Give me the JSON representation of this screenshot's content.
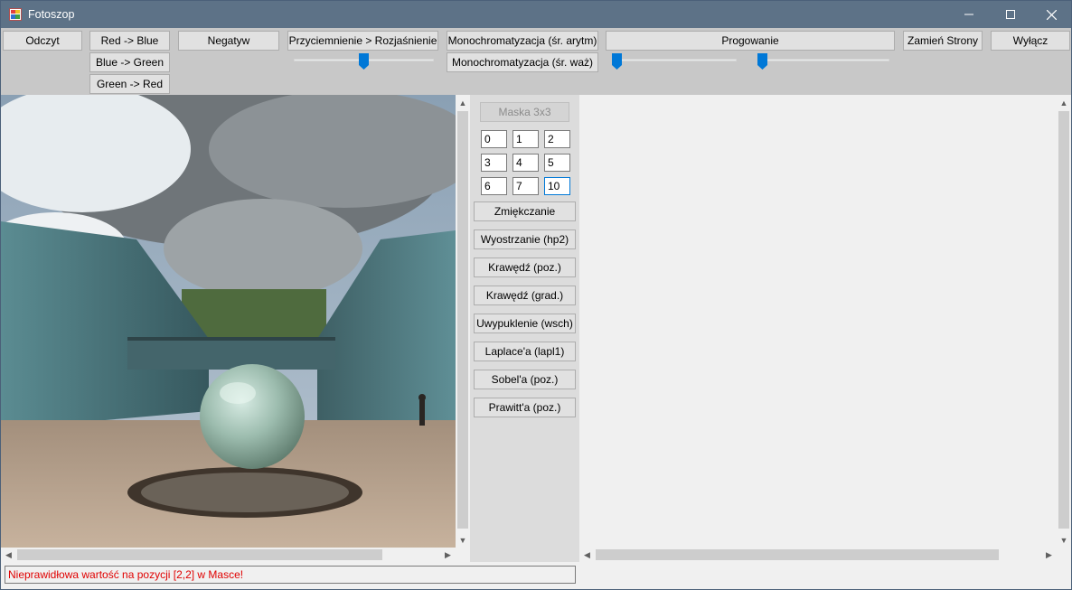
{
  "window": {
    "title": "Fotoszop",
    "controls": {
      "minimize": "minimize-icon",
      "maximize": "maximize-icon",
      "close": "close-icon"
    }
  },
  "toolbar": {
    "read_label": "Odczyt",
    "red_blue_label": "Red -> Blue",
    "blue_green_label": "Blue -> Green",
    "green_red_label": "Green -> Red",
    "negative_label": "Negatyw",
    "brightness_label": "Przyciemnienie > Rozjaśnienie",
    "brightness_slider_value": 0.5,
    "mono_avg_label": "Monochromatyzacja (śr. arytm)",
    "mono_weighted_label": "Monochromatyzacja (śr. waż)",
    "threshold_label": "Progowanie",
    "threshold_slider1_value": 0.0,
    "threshold_slider2_value": 0.0,
    "swap_sides_label": "Zamień Strony",
    "exit_label": "Wyłącz"
  },
  "mask": {
    "title": "Maska 3x3",
    "cells": [
      "0",
      "1",
      "2",
      "3",
      "4",
      "5",
      "6",
      "7",
      "10"
    ]
  },
  "filters": [
    "Zmiękczanie",
    "Wyostrzanie (hp2)",
    "Krawędź (poz.)",
    "Krawędź (grad.)",
    "Uwypuklenie (wsch)",
    "Laplace'a (lapl1)",
    "Sobel'a (poz.)",
    "Prawitt'a (poz.)"
  ],
  "status": {
    "message": "Nieprawidłowa wartość na pozycji [2,2] w Masce!",
    "color": "#e00000"
  },
  "colors": {
    "titlebar": "#5d7287",
    "toolbar": "#c8c8c8",
    "accent": "#0078d7"
  }
}
